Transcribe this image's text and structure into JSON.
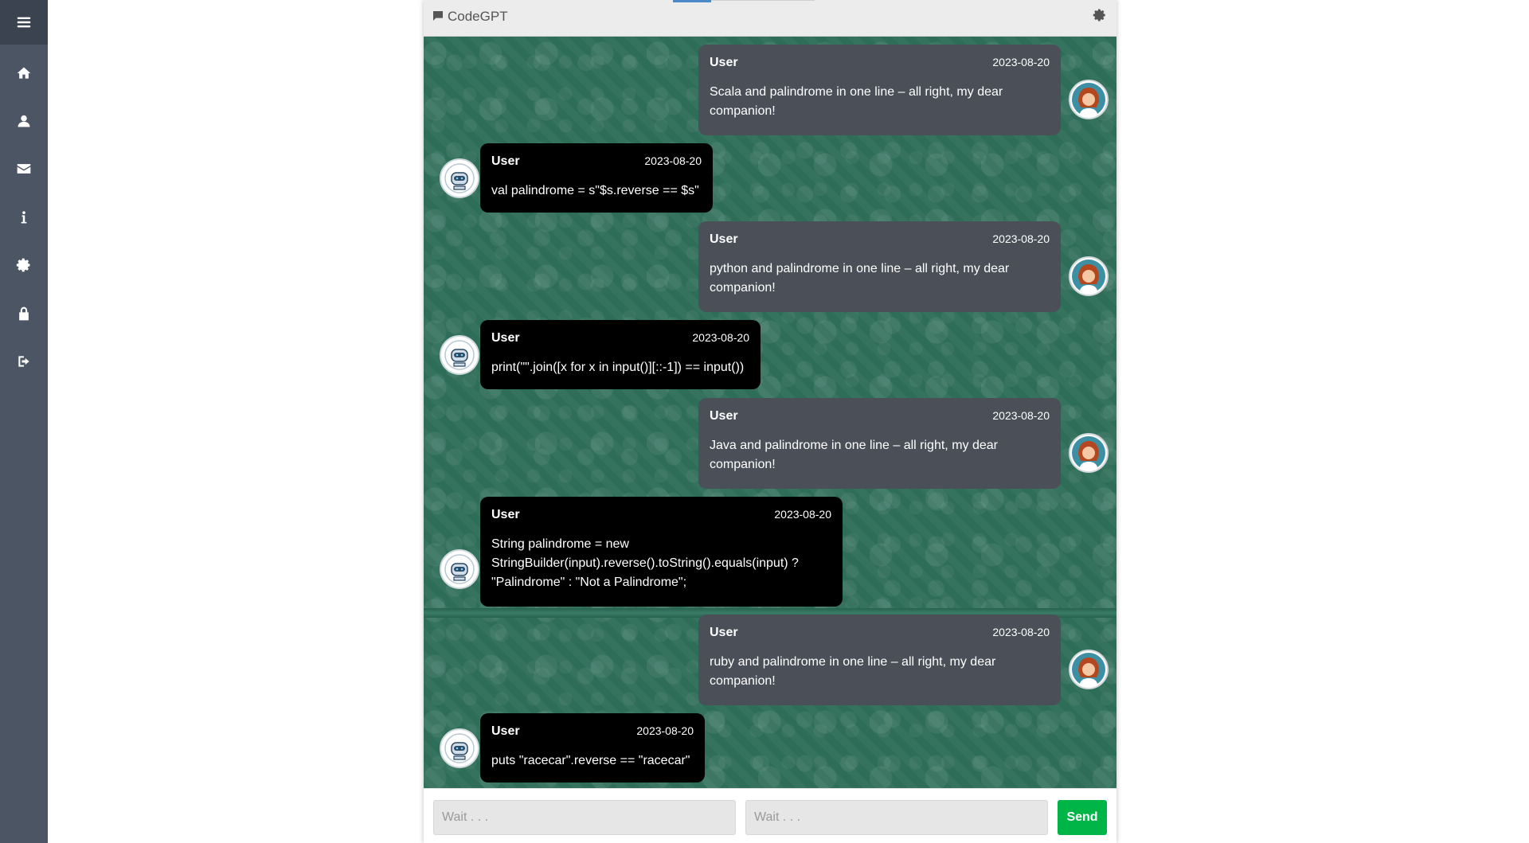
{
  "sidebar": {
    "items": [
      {
        "icon": "menu-icon"
      },
      {
        "icon": "home-icon"
      },
      {
        "icon": "user-icon"
      },
      {
        "icon": "mail-icon"
      },
      {
        "icon": "info-icon"
      },
      {
        "icon": "gear-icon"
      },
      {
        "icon": "lock-icon"
      },
      {
        "icon": "logout-icon"
      }
    ]
  },
  "header": {
    "title": "CodeGPT",
    "logo_icon": "chat-icon",
    "settings_icon": "gear-icon"
  },
  "messages": [
    {
      "role": "user",
      "name": "User",
      "date": "2023-08-20",
      "text": "Scala and palindrome in one line – all right, my dear companion!"
    },
    {
      "role": "bot",
      "name": "User",
      "date": "2023-08-20",
      "text": "val palindrome = s\"$s.reverse == $s\""
    },
    {
      "role": "user",
      "name": "User",
      "date": "2023-08-20",
      "text": "python and palindrome in one line – all right, my dear companion!"
    },
    {
      "role": "bot",
      "name": "User",
      "date": "2023-08-20",
      "text": "print(\"\".join([x for x in input()][::-1]) == input())"
    },
    {
      "role": "user",
      "name": "User",
      "date": "2023-08-20",
      "text": "Java and palindrome in one line – all right, my dear companion!"
    },
    {
      "role": "bot",
      "name": "User",
      "date": "2023-08-20",
      "text": "String palindrome = new StringBuilder(input).reverse().toString().equals(input) ? \"Palindrome\" : \"Not a Palindrome\";"
    },
    {
      "role": "user",
      "name": "User",
      "date": "2023-08-20",
      "text": "ruby and palindrome in one line – all right, my dear companion!"
    },
    {
      "role": "bot",
      "name": "User",
      "date": "2023-08-20",
      "text": "puts \"racecar\".reverse == \"racecar\""
    }
  ],
  "composer": {
    "input1_placeholder": "Wait . . .",
    "input2_placeholder": "Wait . . .",
    "send_label": "Send"
  },
  "colors": {
    "sidebar": "#4b5563",
    "user_bubble": "#4a4f58",
    "bot_bubble": "#000000",
    "chat_background": "#2e6d58",
    "send_button": "#00b547"
  }
}
